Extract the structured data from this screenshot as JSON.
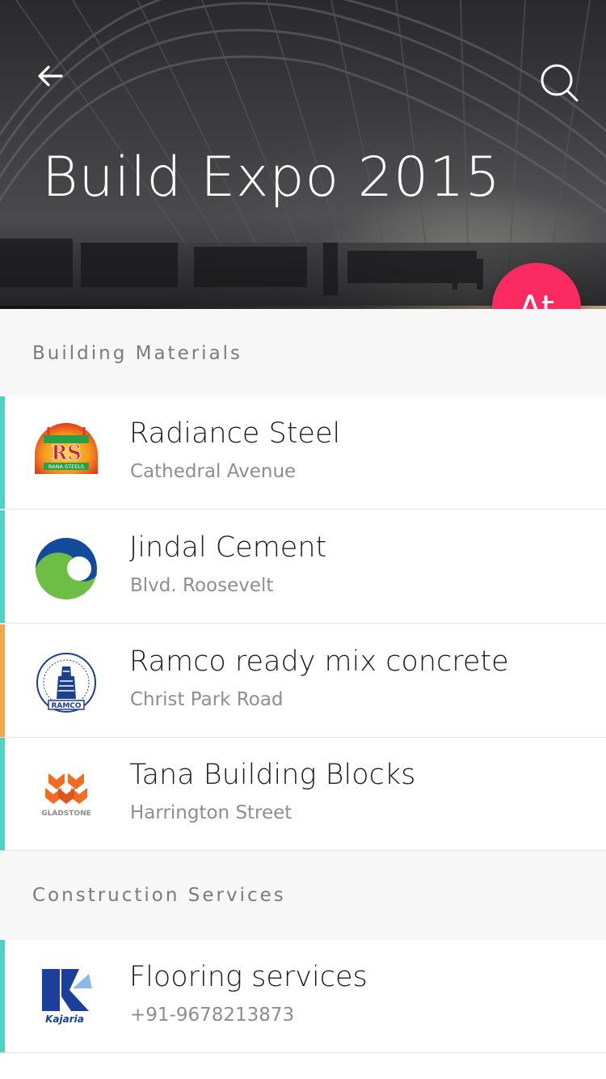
{
  "header": {
    "title": "Build Expo 2015",
    "fab_label": "At"
  },
  "sections": [
    {
      "title": "Building Materials",
      "items": [
        {
          "name": "Radiance Steel",
          "sub": "Cathedral Avenue",
          "logo": "rana-steels-logo",
          "logo_text": "RANA STEELS",
          "accent": "#4dd3c4"
        },
        {
          "name": "Jindal Cement",
          "sub": "Blvd. Roosevelt",
          "logo": "jindal-cement-logo",
          "accent": "#4dd3c4"
        },
        {
          "name": "Ramco ready mix concrete",
          "sub": "Christ Park Road",
          "logo": "ramco-cements-logo",
          "logo_text": "RAMCO",
          "accent": "#f7a54a"
        },
        {
          "name": "Tana Building Blocks",
          "sub": "Harrington Street",
          "logo": "gladstone-logo",
          "logo_text": "GLADSTONE",
          "accent": "#4dd3c4"
        }
      ]
    },
    {
      "title": "Construction Services",
      "items": [
        {
          "name": "Flooring services",
          "sub": "+91-9678213873",
          "logo": "kajaria-logo",
          "logo_text": "Kajaria",
          "accent": "#4dd3c4"
        }
      ]
    }
  ],
  "colors": {
    "fab": "#fb2b62",
    "accent_teal": "#4dd3c4",
    "accent_orange": "#f7a54a",
    "section_bg": "#f7f7f7"
  }
}
